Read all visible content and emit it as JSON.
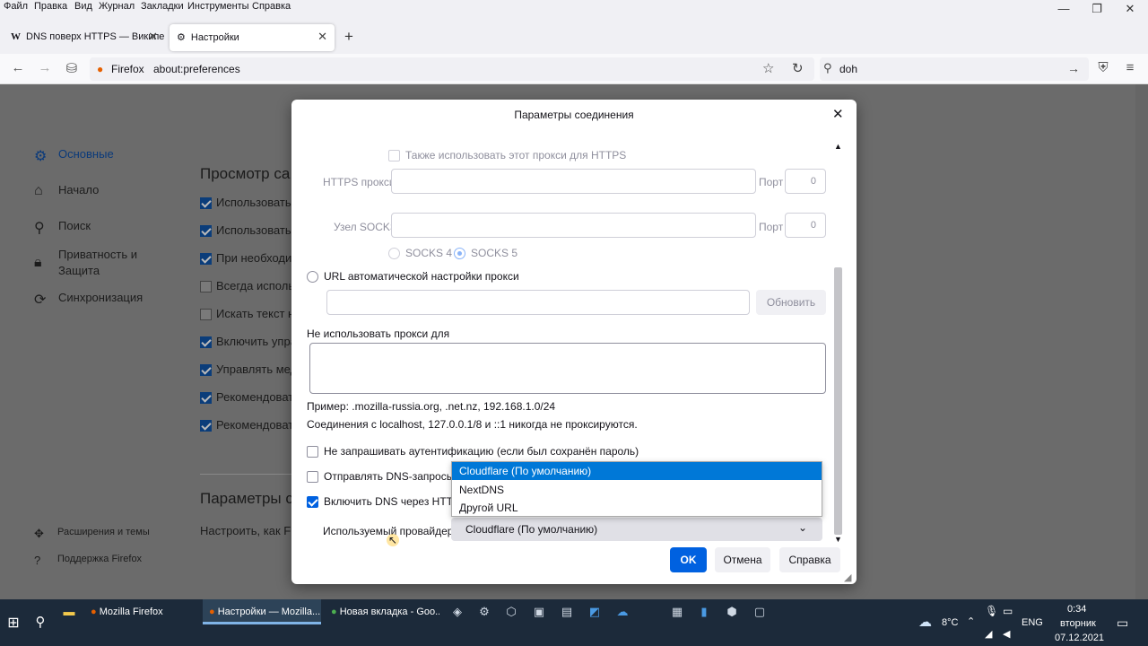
{
  "menubar": {
    "items": [
      "Файл",
      "Правка",
      "Вид",
      "Журнал",
      "Закладки",
      "Инструменты",
      "Справка"
    ],
    "controls": {
      "minimize": "—",
      "maximize": "❐",
      "close": "✕"
    }
  },
  "tabs": [
    {
      "label": "DNS поверх HTTPS — Википе",
      "icon": "wikipedia-icon",
      "favicon": "W",
      "close": "✕"
    },
    {
      "label": "Настройки",
      "icon": "gear-icon",
      "close": "✕"
    }
  ],
  "new_tab": "+",
  "navbar": {
    "identity": "Firefox",
    "url": "about:preferences",
    "search_value": "doh"
  },
  "sidebar": {
    "items": [
      {
        "label": "Основные",
        "icon": "gear-icon",
        "active": true
      },
      {
        "label": "Начало",
        "icon": "home-icon"
      },
      {
        "label": "Поиск",
        "icon": "search-icon"
      },
      {
        "label": "Приватность и",
        "label2": "Защита",
        "icon": "lock-icon"
      },
      {
        "label": "Синхронизация",
        "icon": "sync-icon"
      }
    ],
    "footer": [
      {
        "label": "Расширения и темы",
        "icon": "puzzle-icon"
      },
      {
        "label": "Поддержка Firefox",
        "icon": "help-icon"
      }
    ]
  },
  "background": {
    "section1_title": "Просмотр са",
    "checkboxes": [
      {
        "label": "Использовать",
        "checked": true
      },
      {
        "label": "Использовать",
        "checked": true
      },
      {
        "label": "При необходи",
        "checked": true
      },
      {
        "label": "Всегда исполь",
        "checked": false
      },
      {
        "label": "Искать текст на",
        "checked": false
      },
      {
        "label": "Включить упра",
        "checked": true
      },
      {
        "label": "Управлять мед",
        "checked": true
      },
      {
        "label": "Рекомендовать",
        "checked": true
      },
      {
        "label": "Рекомендовать",
        "checked": true
      }
    ],
    "section2_title": "Параметры с",
    "section2_text": "Настроить, как Fir"
  },
  "dialog": {
    "title": "Параметры соединения",
    "close": "✕",
    "https_also": "Также использовать этот прокси для HTTPS",
    "https_proxy_label": "HTTPS прокси",
    "https_port_label": "Порт",
    "https_port_value": "0",
    "socks_host_label": "Узел SOCKS",
    "socks_port_label": "Порт",
    "socks_port_value": "0",
    "socks4": "SOCKS 4",
    "socks5": "SOCKS 5",
    "auto_url_label": "URL автоматической настройки прокси",
    "reload_button": "Обновить",
    "no_proxy_label": "Не использовать прокси для",
    "example": "Пример: .mozilla-russia.org, .net.nz, 192.168.1.0/24",
    "localhost_note": "Соединения с localhost, 127.0.0.1/8 и ::1 никогда не проксируются.",
    "no_auth": "Не запрашивать аутентификацию (если был сохранён пароль)",
    "dns_socks": "Отправлять DNS-запросы ч",
    "enable_doh": "Включить DNS через HTTPS",
    "provider_label": "Используемый провайдер",
    "provider_selected": "Cloudflare (По умолчанию)",
    "provider_options": [
      "Cloudflare (По умолчанию)",
      "NextDNS",
      "Другой URL"
    ],
    "ok": "OK",
    "cancel": "Отмена",
    "help": "Справка"
  },
  "taskbar": {
    "apps": [
      {
        "label": "Mozilla Firefox"
      },
      {
        "label": "Настройки — Mozilla...",
        "active": true
      },
      {
        "label": "Новая вкладка - Goo..."
      }
    ],
    "weather": "8°C",
    "lang": "ENG",
    "time": "0:34",
    "weekday": "вторник",
    "date": "07.12.2021"
  },
  "colors": {
    "accent": "#0061e0",
    "select_blue": "#0078d7",
    "overlay": "#6b6b6b",
    "taskbar": "#1c2a3a"
  }
}
